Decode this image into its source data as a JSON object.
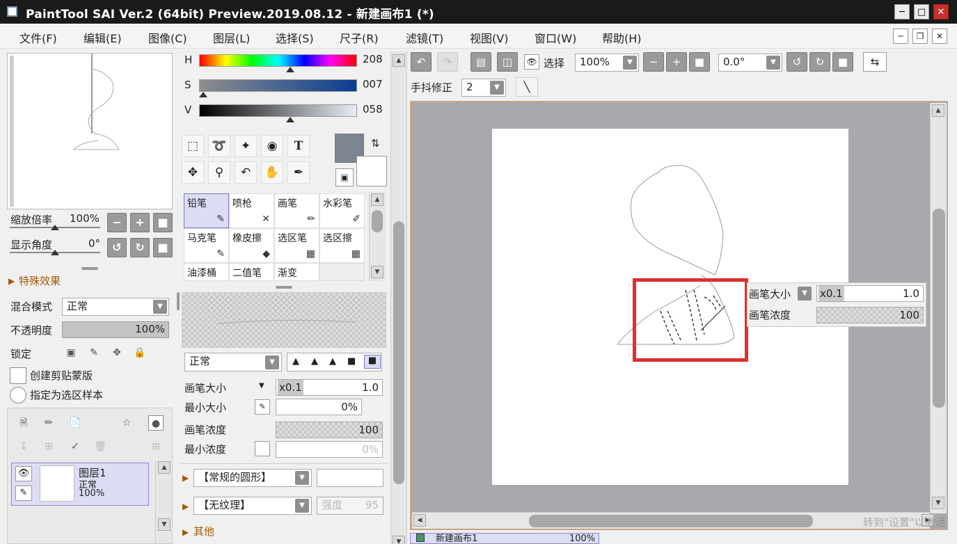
{
  "window": {
    "title": "PaintTool SAI Ver.2 (64bit) Preview.2019.08.12 - 新建画布1 (*)"
  },
  "menu": [
    "文件(F)",
    "编辑(E)",
    "图像(C)",
    "图层(L)",
    "选择(S)",
    "尺子(R)",
    "滤镜(T)",
    "视图(V)",
    "窗口(W)",
    "帮助(H)"
  ],
  "navigator": {
    "zoom_label": "缩放倍率",
    "zoom_value": "100%",
    "angle_label": "显示角度",
    "angle_value": "0°"
  },
  "effects": {
    "label": "特殊效果"
  },
  "layer_props": {
    "blend_label": "混合模式",
    "blend_value": "正常",
    "opacity_label": "不透明度",
    "opacity_value": "100%",
    "lock_label": "锁定",
    "clip_label": "创建剪贴蒙版",
    "sample_label": "指定为选区样本"
  },
  "layers": [
    {
      "name": "图层1",
      "mode": "正常",
      "opacity": "100%"
    }
  ],
  "color": {
    "h_label": "H",
    "h_value": "208",
    "h_fraction": 0.577,
    "s_label": "S",
    "s_value": "007",
    "s_fraction": 0.027,
    "v_label": "V",
    "v_value": "058",
    "v_fraction": 0.579,
    "fg_color": "#7d8591",
    "bg_color": "#ffffff"
  },
  "tools": [
    "selection-rect-icon",
    "lasso-icon",
    "magic-wand-icon",
    "shape-icon",
    "text-icon",
    "move-icon",
    "zoom-icon",
    "rotate-icon",
    "hand-icon",
    "eyedropper-icon"
  ],
  "text_tool_glyph": "T",
  "brushes": [
    {
      "name": "铅笔",
      "selected": true
    },
    {
      "name": "喷枪",
      "selected": false
    },
    {
      "name": "画笔",
      "selected": false
    },
    {
      "name": "水彩笔",
      "selected": false
    },
    {
      "name": "马克笔",
      "selected": false
    },
    {
      "name": "橡皮擦",
      "selected": false
    },
    {
      "name": "选区笔",
      "selected": false
    },
    {
      "name": "选区擦",
      "selected": false
    },
    {
      "name": "油漆桶",
      "selected": false
    },
    {
      "name": "二值笔",
      "selected": false
    },
    {
      "name": "渐变",
      "selected": false
    }
  ],
  "brush_settings": {
    "mode_value": "正常",
    "size_label": "画笔大小",
    "size_mult": "x0.1",
    "size_value": "1.0",
    "min_size_label": "最小大小",
    "min_size_value": "0%",
    "density_label": "画笔浓度",
    "density_value": "100",
    "min_density_label": "最小浓度",
    "min_density_value": "0%",
    "shape_value": "【常规的圆形】",
    "texture_value": "【无纹理】",
    "strength_label": "强度",
    "strength_value": "95",
    "other_label": "其他"
  },
  "toolbar": {
    "select_label": "选择",
    "zoom_value": "100%",
    "angle_value": "0.0°",
    "stabilizer_label": "手抖修正",
    "stabilizer_value": "2"
  },
  "popup": {
    "size_label": "画笔大小",
    "size_mult": "x0.1",
    "size_value": "1.0",
    "density_label": "画笔浓度",
    "density_value": "100"
  },
  "highlight_color": "#e03030",
  "document_tab": {
    "name": "新建画布1",
    "zoom": "100%"
  },
  "watermark": "转到\"设置\"以激活"
}
